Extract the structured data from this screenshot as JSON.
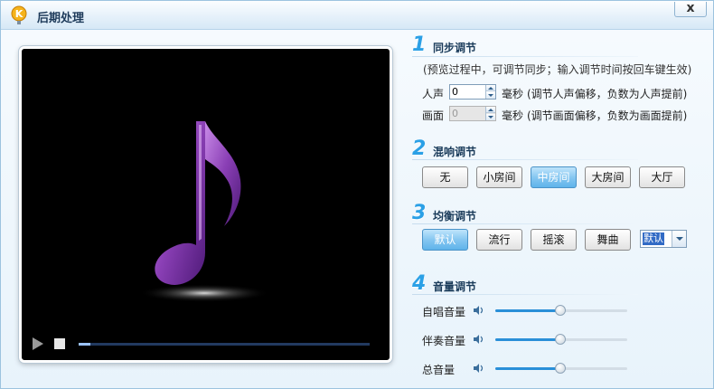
{
  "window": {
    "title": "后期处理",
    "close_label": "x"
  },
  "player": {
    "progress": 0.04
  },
  "sync": {
    "number": "1",
    "title": "同步调节",
    "hint": "(预览过程中，可调节同步；输入调节时间按回车键生效)",
    "voice_label": "人声",
    "voice_value": "0",
    "voice_unit": "毫秒",
    "voice_desc": "(调节人声偏移，负数为人声提前)",
    "picture_label": "画面",
    "picture_value": "0",
    "picture_unit": "毫秒",
    "picture_desc": "(调节画面偏移，负数为画面提前)"
  },
  "reverb": {
    "number": "2",
    "title": "混响调节",
    "options": [
      "无",
      "小房间",
      "中房间",
      "大房间",
      "大厅"
    ],
    "selected": "中房间"
  },
  "eq": {
    "number": "3",
    "title": "均衡调节",
    "options": [
      "默认",
      "流行",
      "摇滚",
      "舞曲"
    ],
    "selected": "默认",
    "combo_value": "默认"
  },
  "volume": {
    "number": "4",
    "title": "音量调节",
    "items": [
      {
        "label": "自唱音量",
        "level": 0.49
      },
      {
        "label": "伴奏音量",
        "level": 0.49
      },
      {
        "label": "总音量",
        "level": 0.49
      }
    ]
  },
  "colors": {
    "accent": "#2ba0e6",
    "active_button": "#86c7f1",
    "note_purple": "#8a3fb5"
  }
}
